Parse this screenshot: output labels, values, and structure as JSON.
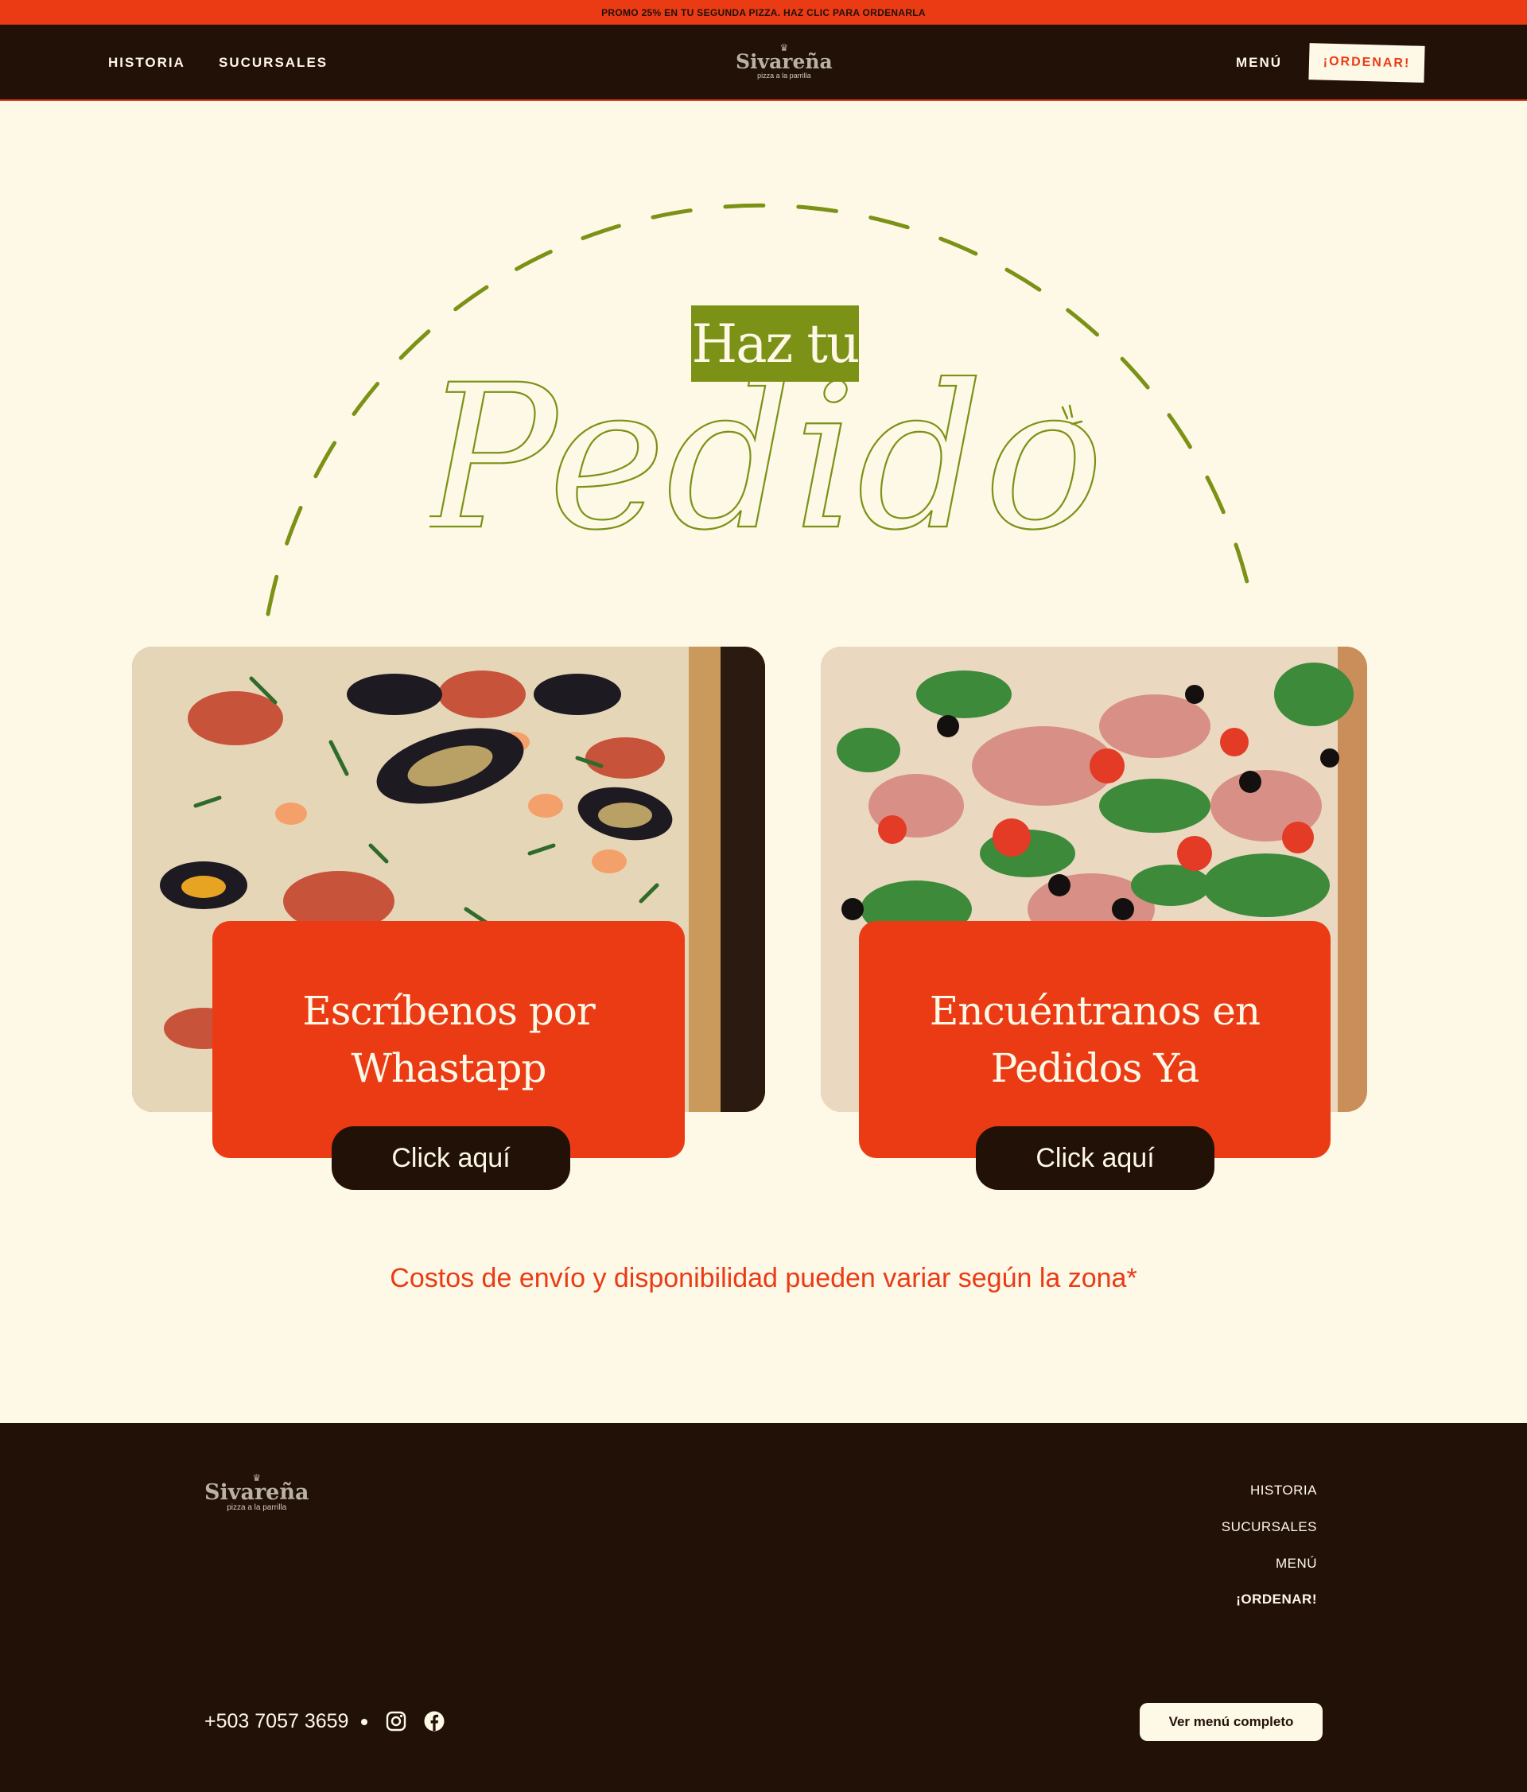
{
  "promo": {
    "text": "PROMO 25% EN TU SEGUNDA PIZZA. HAZ CLIC PARA ORDENARLA"
  },
  "header": {
    "nav_left": [
      "HISTORIA",
      "SUCURSALES"
    ],
    "menu_label": "MENÚ",
    "order_label": "¡ORDENAR!",
    "logo": {
      "name": "Sivareña",
      "tagline": "pizza a la parrilla"
    }
  },
  "hero": {
    "title_top": "Haz tu",
    "title_script": "Pedido"
  },
  "cards": [
    {
      "title_line1": "Escríbenos por",
      "title_line2": "Whastapp",
      "button": "Click aquí",
      "image": "seafood-pizza-photo"
    },
    {
      "title_line1": "Encuéntranos en",
      "title_line2": "Pedidos Ya",
      "button": "Click aquí",
      "image": "prosciutto-arugula-pizza-photo"
    }
  ],
  "disclaimer": "Costos de envío y disponibilidad pueden variar según la zona*",
  "footer": {
    "logo": {
      "name": "Sivareña",
      "tagline": "pizza a la parrilla"
    },
    "links": [
      "HISTORIA",
      "SUCURSALES",
      "MENÚ",
      "¡ORDENAR!"
    ],
    "phone": "+503 7057 3659",
    "social_icons": [
      "instagram-icon",
      "facebook-icon"
    ],
    "menu_button": "Ver menú completo"
  },
  "colors": {
    "accent": "#ea3b15",
    "dark": "#221107",
    "cream": "#fef8e7",
    "olive": "#7b9216"
  }
}
